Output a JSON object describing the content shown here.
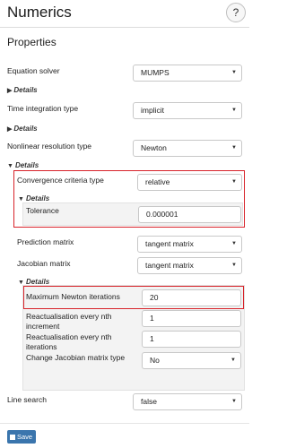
{
  "header": {
    "title": "Numerics",
    "help_glyph": "?"
  },
  "section": {
    "title": "Properties"
  },
  "fields": {
    "equation_solver": {
      "label": "Equation solver",
      "value": "MUMPS"
    },
    "time_integration": {
      "label": "Time integration type",
      "value": "implicit"
    },
    "nonlinear_resolution": {
      "label": "Nonlinear resolution type",
      "value": "Newton"
    },
    "convergence_criteria": {
      "label": "Convergence criteria type",
      "value": "relative"
    },
    "tolerance": {
      "label": "Tolerance",
      "value": "0.000001"
    },
    "prediction_matrix": {
      "label": "Prediction matrix",
      "value": "tangent matrix"
    },
    "jacobian_matrix": {
      "label": "Jacobian matrix",
      "value": "tangent matrix"
    },
    "max_newton_iterations": {
      "label": "Maximum Newton iterations",
      "value": "20"
    },
    "reactualisation_increment": {
      "label_line1": "Reactualisation every nth",
      "label_line2": "increment",
      "value": "1"
    },
    "reactualisation_iterations": {
      "label_line1": "Reactualisation every nth",
      "label_line2": "iterations",
      "value": "1"
    },
    "change_jacobian": {
      "label": "Change Jacobian matrix type",
      "value": "No"
    },
    "line_search": {
      "label": "Line search",
      "value": "false"
    }
  },
  "details_label": "Details",
  "save_label": "Save",
  "icons": {
    "collapsed": "triangle-right-icon",
    "expanded": "triangle-down-icon",
    "select": "caret-down-icon",
    "save": "floppy-icon"
  },
  "colors": {
    "highlight": "#d8232a",
    "primary": "#3a75ad"
  }
}
